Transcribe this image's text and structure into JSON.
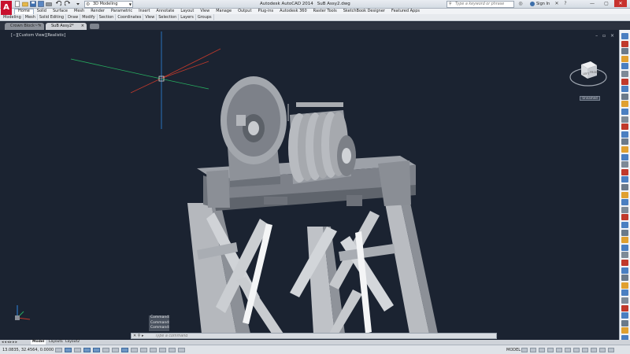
{
  "app": {
    "logo_letter": "A",
    "title": "Autodesk AutoCAD 2014",
    "drawing_name": "SuB Assy2.dwg",
    "workspace": "3D Modeling",
    "search_placeholder": "Type a keyword or phrase",
    "sign_in": "Sign In"
  },
  "ribbon_tabs": [
    {
      "label": "Home",
      "active": true
    },
    {
      "label": "Solid"
    },
    {
      "label": "Surface"
    },
    {
      "label": "Mesh"
    },
    {
      "label": "Render"
    },
    {
      "label": "Parametric"
    },
    {
      "label": "Insert"
    },
    {
      "label": "Annotate"
    },
    {
      "label": "Layout"
    },
    {
      "label": "View"
    },
    {
      "label": "Manage"
    },
    {
      "label": "Output"
    },
    {
      "label": "Plug-ins"
    },
    {
      "label": "Autodesk 360"
    },
    {
      "label": "Raster Tools"
    },
    {
      "label": "SketchBook Designer"
    },
    {
      "label": "Featured Apps"
    }
  ],
  "panels": [
    "Modeling",
    "Mesh",
    "Solid Editing",
    "Draw",
    "Modify",
    "Section",
    "Coordinates",
    "View",
    "Selection",
    "Layers",
    "Groups"
  ],
  "file_tabs": [
    {
      "label": "Crown Block~*",
      "active": false
    },
    {
      "label": "SuB Assy2*",
      "active": true
    }
  ],
  "viewport": {
    "label": "[−][Custom View][Realistic]",
    "wcs": "Unnamed"
  },
  "command": {
    "history": [
      "Command:",
      "Command:",
      "Command:"
    ],
    "placeholder": "Type a command"
  },
  "layout_tabs": [
    "Model",
    "Layout1",
    "Layout2"
  ],
  "status": {
    "coords": "13.0835, 32.4564, 0.0000",
    "model": "MODEL"
  },
  "colors": {
    "viewport_bg": "#1b2331",
    "logo_red": "#c8102e",
    "axis_x": "#c0392b",
    "axis_y": "#27ae60",
    "axis_z": "#2e86de"
  }
}
